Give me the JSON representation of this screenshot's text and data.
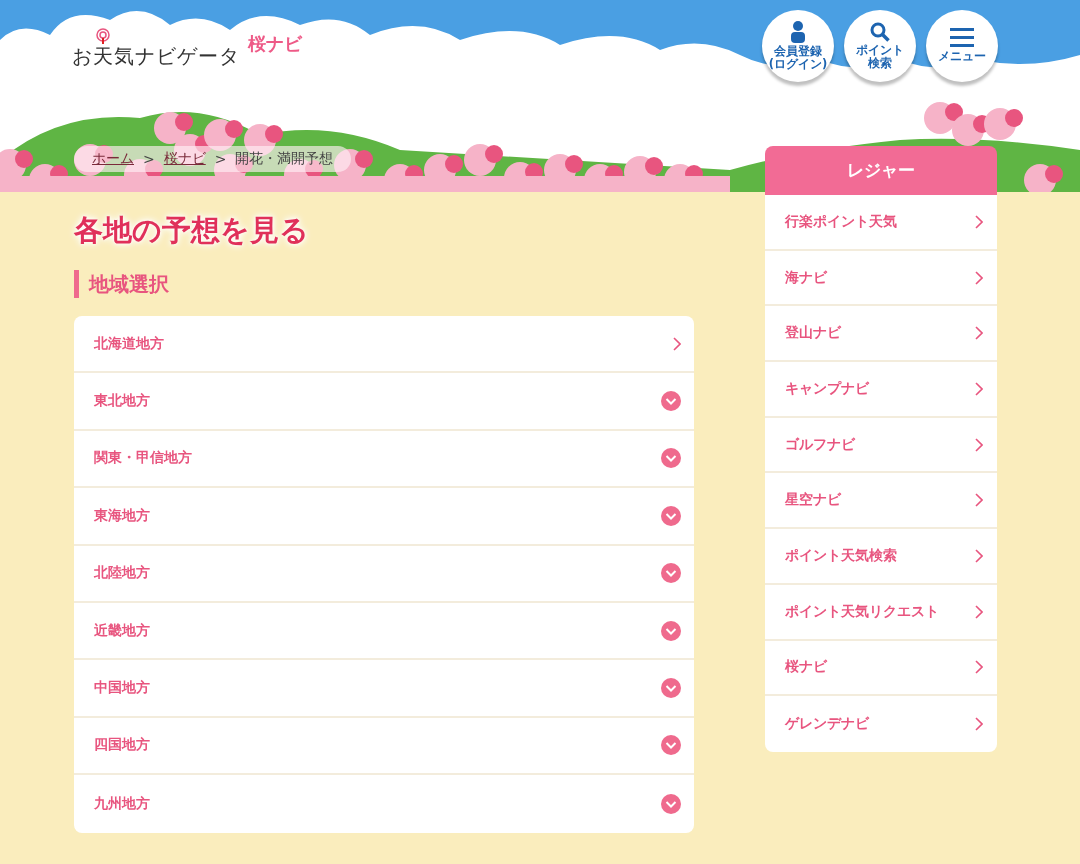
{
  "header": {
    "logo": "お天気ナビゲータ",
    "sublogo": "桜ナビ",
    "buttons": [
      {
        "kind": "member",
        "label": "会員登録",
        "sub": "(ログイン)"
      },
      {
        "kind": "search",
        "label": "ポイント",
        "sub": "検索"
      },
      {
        "kind": "menu",
        "label": "メニュー"
      }
    ]
  },
  "breadcrumb": [
    {
      "label": "ホーム",
      "link": true
    },
    {
      "label": "桜ナビ",
      "link": true
    },
    {
      "label": "開花・満開予想",
      "link": false
    }
  ],
  "breadcrumb_separator": ">",
  "page_title": "各地の予想を見る",
  "section_title": "地域選択",
  "regions": [
    {
      "label": "北海道地方",
      "kind": "link"
    },
    {
      "label": "東北地方",
      "kind": "expand",
      "expanded": false
    },
    {
      "label": "関東・甲信地方",
      "kind": "expand",
      "expanded": false
    },
    {
      "label": "東海地方",
      "kind": "expand",
      "expanded": false
    },
    {
      "label": "北陸地方",
      "kind": "expand",
      "expanded": false
    },
    {
      "label": "近畿地方",
      "kind": "expand",
      "expanded": false
    },
    {
      "label": "中国地方",
      "kind": "expand",
      "expanded": false
    },
    {
      "label": "四国地方",
      "kind": "expand",
      "expanded": false
    },
    {
      "label": "九州地方",
      "kind": "expand",
      "expanded": false
    }
  ],
  "sidebar": {
    "title": "レジャー",
    "items": [
      "行楽ポイント天気",
      "海ナビ",
      "登山ナビ",
      "キャンプナビ",
      "ゴルフナビ",
      "星空ナビ",
      "ポイント天気検索",
      "ポイント天気リクエスト",
      "桜ナビ",
      "ゲレンデナビ"
    ]
  }
}
